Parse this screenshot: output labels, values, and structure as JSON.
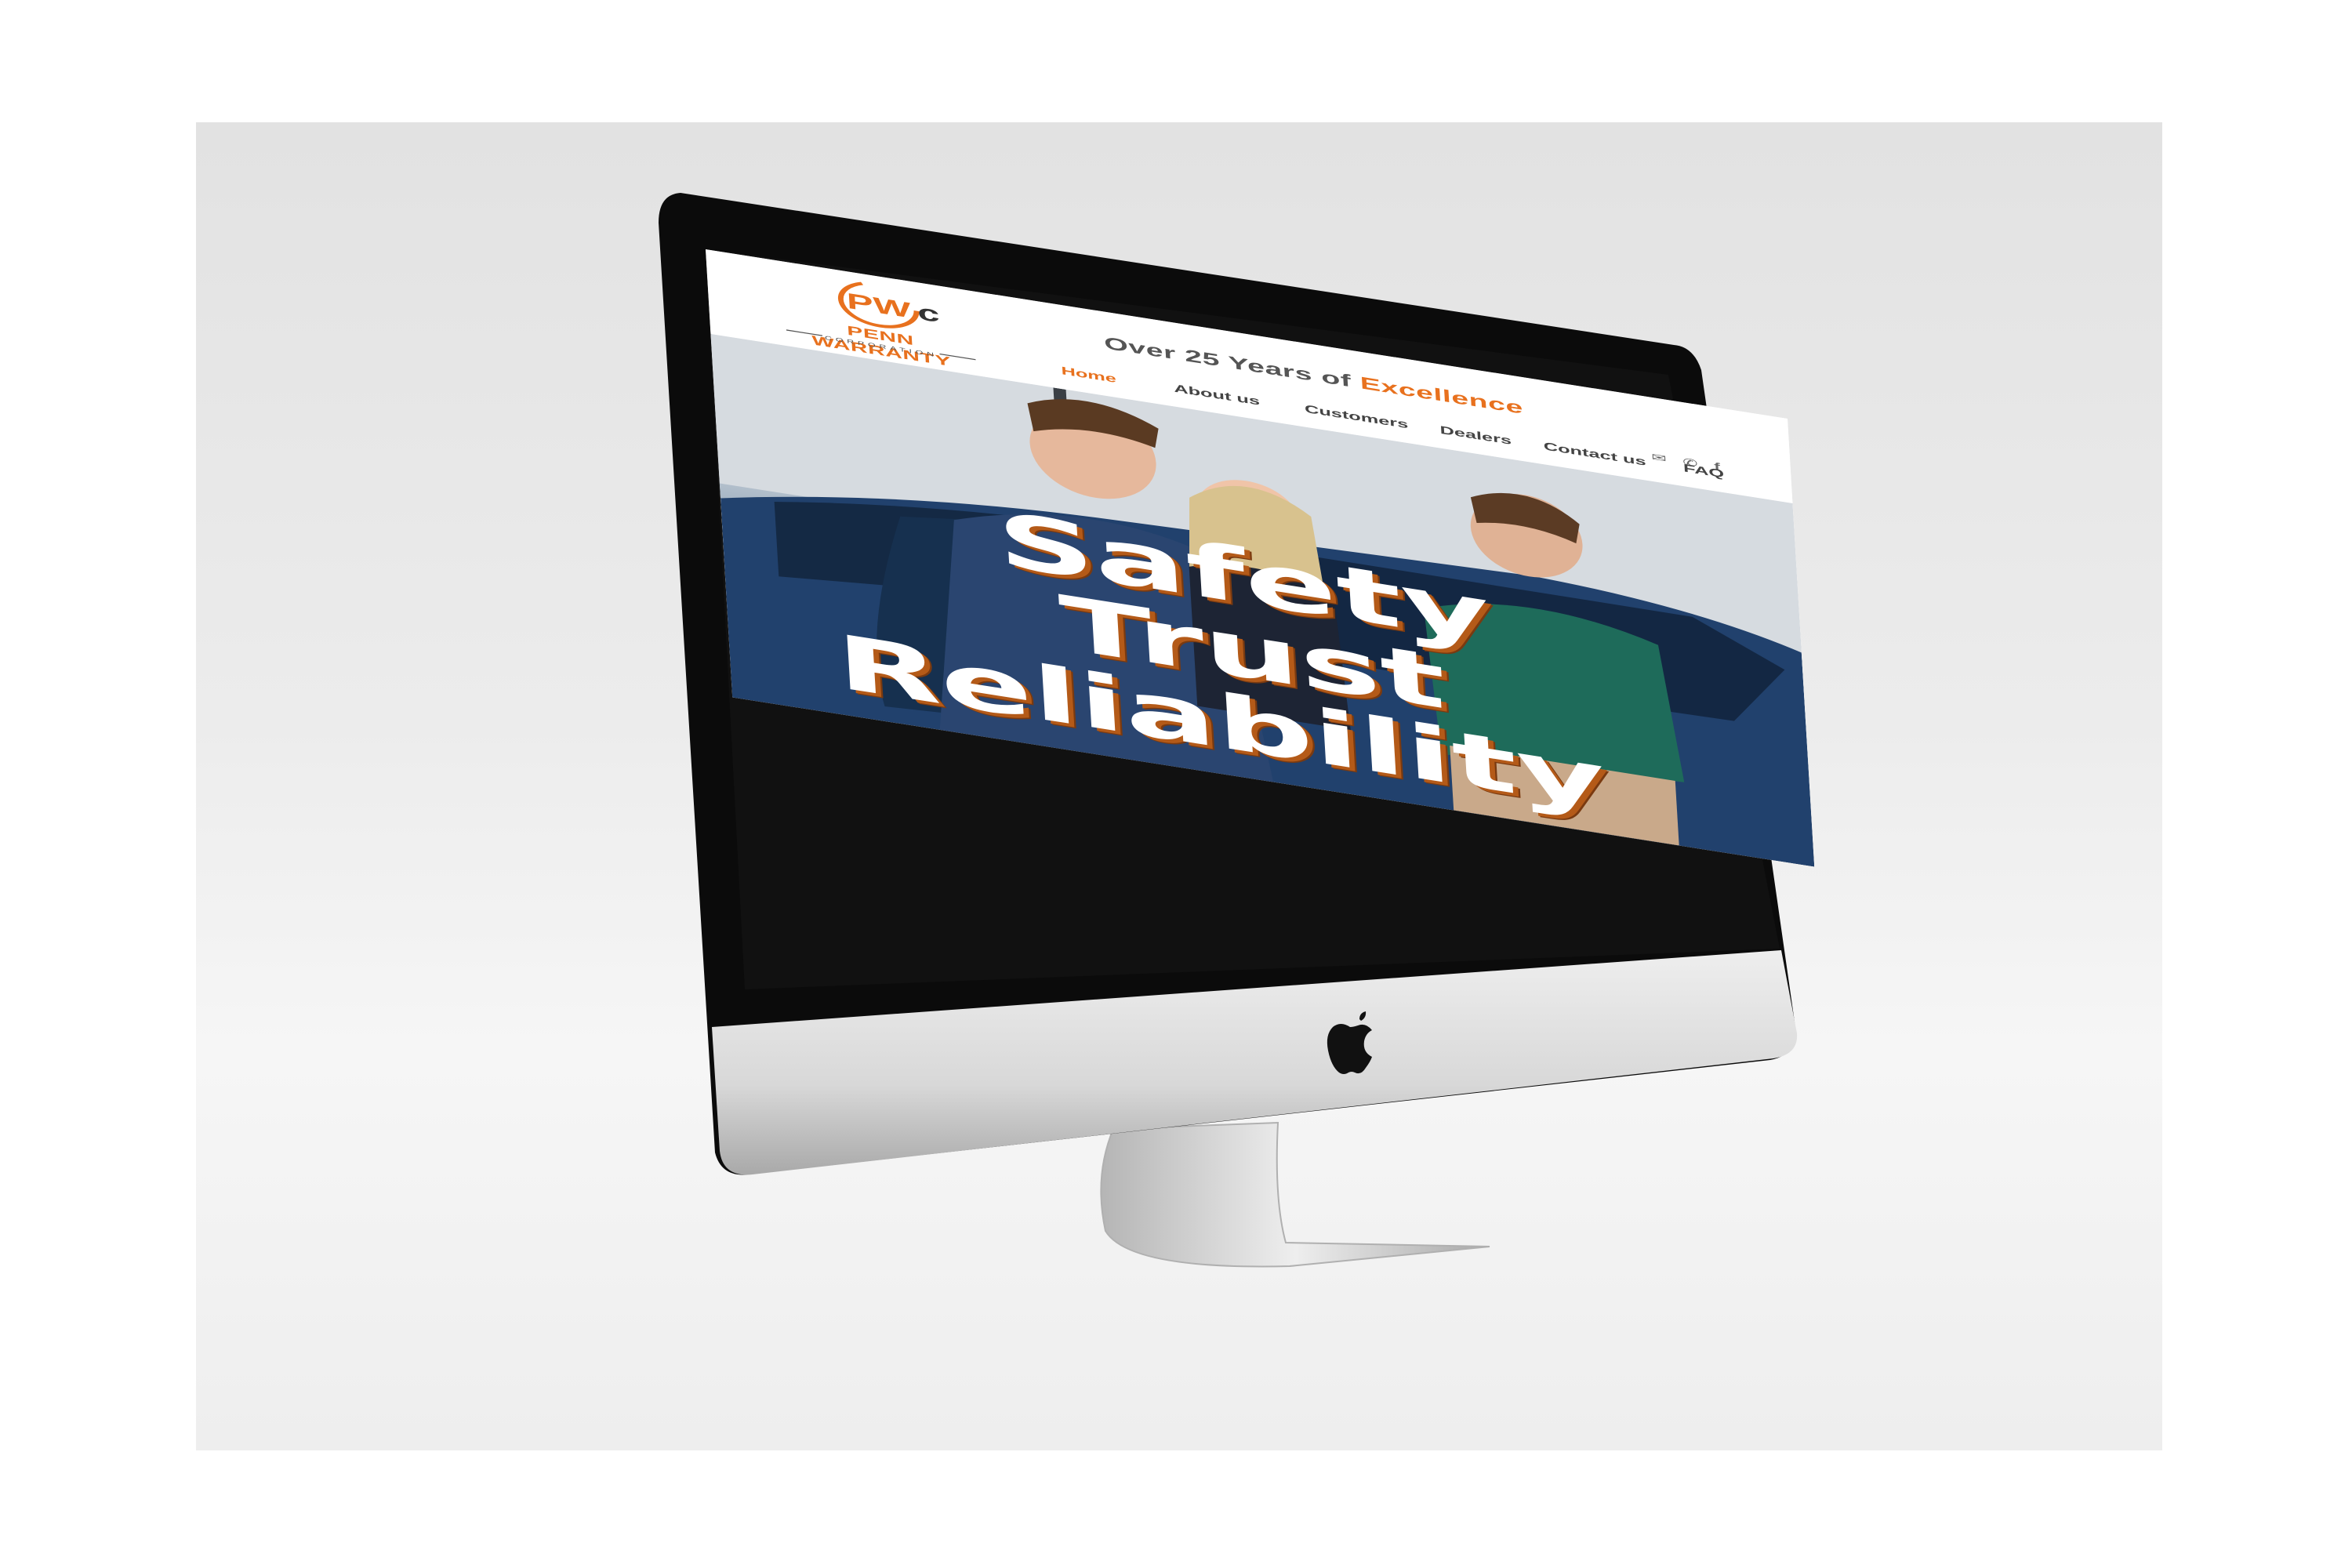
{
  "site": {
    "logo": {
      "monogram": "PWC",
      "name": "PENN WARRANTY",
      "sub": "CORPORATION"
    },
    "tagline": {
      "prefix": "Over 25 Years of ",
      "accent": "Excellence"
    },
    "nav": [
      {
        "label": "Home",
        "active": true
      },
      {
        "label": "About us",
        "active": false
      },
      {
        "label": "Customers",
        "active": false
      },
      {
        "label": "Dealers",
        "active": false
      },
      {
        "label": "Contact us",
        "active": false
      },
      {
        "label": "FAQ",
        "active": false
      }
    ],
    "contact_icons": [
      "email-icon",
      "phone-icon",
      "facebook-icon"
    ],
    "hero": {
      "line1": "Safety",
      "line2": "Trust",
      "line3": "Reliability"
    },
    "colors": {
      "accent": "#e8711e",
      "text": "#444444"
    }
  }
}
